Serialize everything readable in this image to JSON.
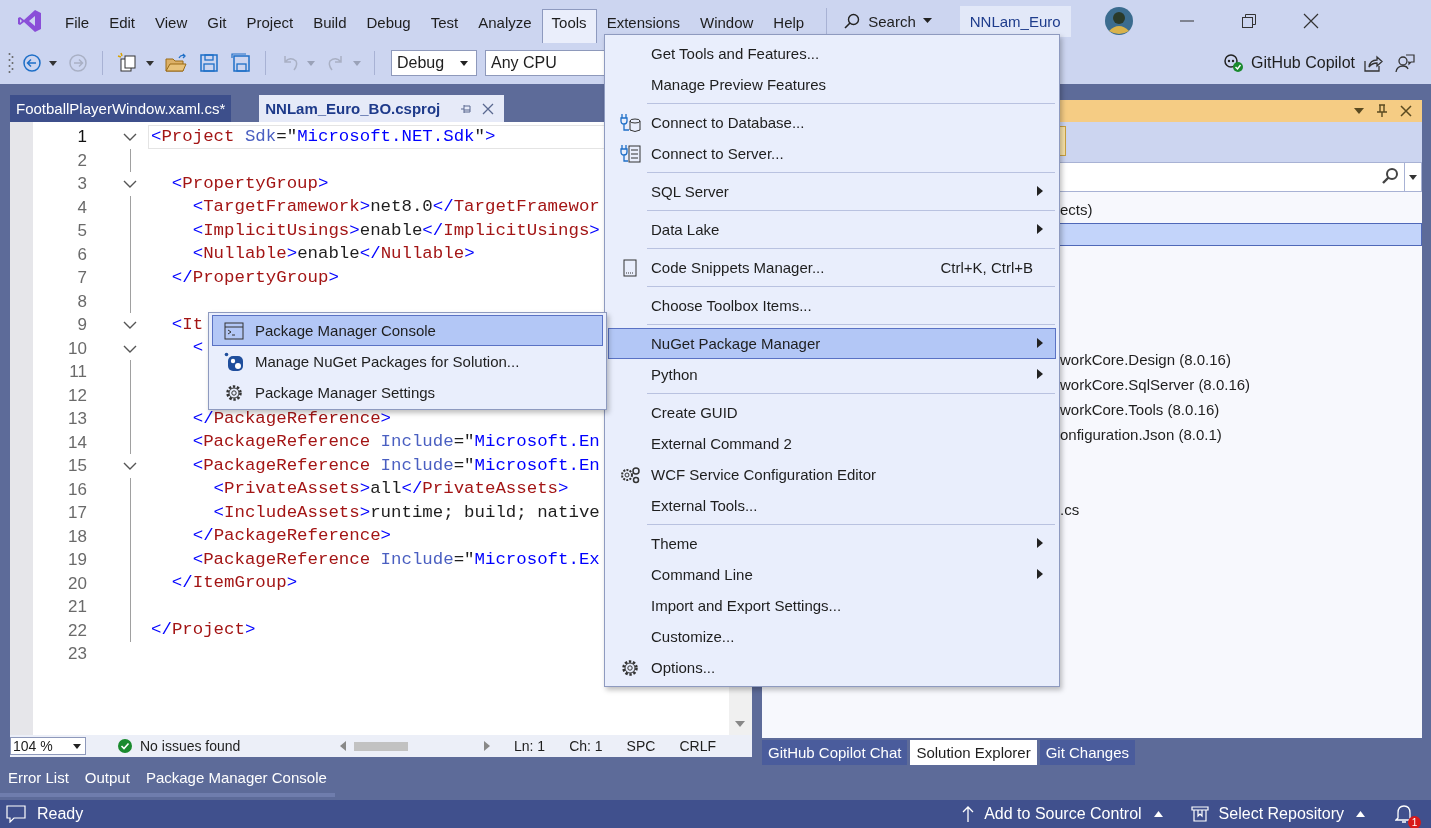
{
  "menu_bar": {
    "items": [
      {
        "label": "File",
        "selected": false
      },
      {
        "label": "Edit",
        "selected": false
      },
      {
        "label": "View",
        "selected": false
      },
      {
        "label": "Git",
        "selected": false
      },
      {
        "label": "Project",
        "selected": false
      },
      {
        "label": "Build",
        "selected": false
      },
      {
        "label": "Debug",
        "selected": false
      },
      {
        "label": "Test",
        "selected": false
      },
      {
        "label": "Analyze",
        "selected": false
      },
      {
        "label": "Tools",
        "selected": true
      },
      {
        "label": "Extensions",
        "selected": false
      },
      {
        "label": "Window",
        "selected": false
      },
      {
        "label": "Help",
        "selected": false
      }
    ],
    "search": "Search",
    "solution_name": "NNLam_Euro"
  },
  "toolbar": {
    "configuration": "Debug",
    "platform": "Any CPU",
    "copilot": "GitHub Copilot"
  },
  "editor": {
    "tabs": [
      {
        "label": "FootballPlayerWindow.xaml.cs*",
        "selected": false
      },
      {
        "label": "NNLam_Euro_BO.csproj",
        "selected": true
      }
    ],
    "lines": [
      {
        "number": "1",
        "current": true,
        "foldable": true,
        "tokens": [
          {
            "kind": "bracket",
            "text": "<"
          },
          {
            "kind": "tag",
            "text": "Project"
          },
          {
            "kind": "attr",
            "text": " Sdk"
          },
          {
            "kind": "punct",
            "text": "=\""
          },
          {
            "kind": "value",
            "text": "Microsoft.NET.Sdk"
          },
          {
            "kind": "punct",
            "text": "\""
          },
          {
            "kind": "bracket",
            "text": ">"
          }
        ]
      },
      {
        "number": "2",
        "current": false,
        "foldable": false
      },
      {
        "number": "3",
        "current": false,
        "foldable": true,
        "tokens": [
          {
            "kind": "bracket",
            "text": "  <"
          },
          {
            "kind": "tag",
            "text": "PropertyGroup"
          },
          {
            "kind": "bracket",
            "text": ">"
          }
        ]
      },
      {
        "number": "4",
        "current": false,
        "foldable": false,
        "tokens": [
          {
            "kind": "bracket",
            "text": "    <"
          },
          {
            "kind": "tag",
            "text": "TargetFramework"
          },
          {
            "kind": "bracket",
            "text": ">"
          },
          {
            "kind": "text",
            "text": "net8.0"
          },
          {
            "kind": "bracket",
            "text": "</"
          },
          {
            "kind": "tag",
            "text": "TargetFramewor"
          }
        ]
      },
      {
        "number": "5",
        "current": false,
        "foldable": false,
        "tokens": [
          {
            "kind": "bracket",
            "text": "    <"
          },
          {
            "kind": "tag",
            "text": "ImplicitUsings"
          },
          {
            "kind": "bracket",
            "text": ">"
          },
          {
            "kind": "text",
            "text": "enable"
          },
          {
            "kind": "bracket",
            "text": "</"
          },
          {
            "kind": "tag",
            "text": "ImplicitUsings"
          },
          {
            "kind": "bracket",
            "text": ">"
          }
        ]
      },
      {
        "number": "6",
        "current": false,
        "foldable": false,
        "tokens": [
          {
            "kind": "bracket",
            "text": "    <"
          },
          {
            "kind": "tag",
            "text": "Nullable"
          },
          {
            "kind": "bracket",
            "text": ">"
          },
          {
            "kind": "text",
            "text": "enable"
          },
          {
            "kind": "bracket",
            "text": "</"
          },
          {
            "kind": "tag",
            "text": "Nullable"
          },
          {
            "kind": "bracket",
            "text": ">"
          }
        ]
      },
      {
        "number": "7",
        "current": false,
        "foldable": false,
        "tokens": [
          {
            "kind": "bracket",
            "text": "  </"
          },
          {
            "kind": "tag",
            "text": "PropertyGroup"
          },
          {
            "kind": "bracket",
            "text": ">"
          }
        ]
      },
      {
        "number": "8",
        "current": false,
        "foldable": false
      },
      {
        "number": "9",
        "current": false,
        "foldable": true,
        "tokens": [
          {
            "kind": "bracket",
            "text": "  <"
          },
          {
            "kind": "tag",
            "text": "It"
          }
        ]
      },
      {
        "number": "10",
        "current": false,
        "foldable": true,
        "tokens": [
          {
            "kind": "bracket",
            "text": "    <"
          }
        ]
      },
      {
        "number": "11",
        "current": false,
        "foldable": false
      },
      {
        "number": "12",
        "current": false,
        "foldable": false
      },
      {
        "number": "13",
        "current": false,
        "foldable": false,
        "tokens": [
          {
            "kind": "bracket",
            "text": "    </"
          },
          {
            "kind": "tag",
            "text": "PackageReference"
          },
          {
            "kind": "bracket",
            "text": ">"
          }
        ]
      },
      {
        "number": "14",
        "current": false,
        "foldable": false,
        "tokens": [
          {
            "kind": "bracket",
            "text": "    <"
          },
          {
            "kind": "tag",
            "text": "PackageReference"
          },
          {
            "kind": "attr",
            "text": " Include"
          },
          {
            "kind": "punct",
            "text": "=\""
          },
          {
            "kind": "value",
            "text": "Microsoft.En"
          }
        ]
      },
      {
        "number": "15",
        "current": false,
        "foldable": true,
        "tokens": [
          {
            "kind": "bracket",
            "text": "    <"
          },
          {
            "kind": "tag",
            "text": "PackageReference"
          },
          {
            "kind": "attr",
            "text": " Include"
          },
          {
            "kind": "punct",
            "text": "=\""
          },
          {
            "kind": "value",
            "text": "Microsoft.En"
          }
        ]
      },
      {
        "number": "16",
        "current": false,
        "foldable": false,
        "tokens": [
          {
            "kind": "bracket",
            "text": "      <"
          },
          {
            "kind": "tag",
            "text": "PrivateAssets"
          },
          {
            "kind": "bracket",
            "text": ">"
          },
          {
            "kind": "text",
            "text": "all"
          },
          {
            "kind": "bracket",
            "text": "</"
          },
          {
            "kind": "tag",
            "text": "PrivateAssets"
          },
          {
            "kind": "bracket",
            "text": ">"
          }
        ]
      },
      {
        "number": "17",
        "current": false,
        "foldable": false,
        "tokens": [
          {
            "kind": "bracket",
            "text": "      <"
          },
          {
            "kind": "tag",
            "text": "IncludeAssets"
          },
          {
            "kind": "bracket",
            "text": ">"
          },
          {
            "kind": "text",
            "text": "runtime; build; native"
          }
        ]
      },
      {
        "number": "18",
        "current": false,
        "foldable": false,
        "tokens": [
          {
            "kind": "bracket",
            "text": "    </"
          },
          {
            "kind": "tag",
            "text": "PackageReference"
          },
          {
            "kind": "bracket",
            "text": ">"
          }
        ]
      },
      {
        "number": "19",
        "current": false,
        "foldable": false,
        "tokens": [
          {
            "kind": "bracket",
            "text": "    <"
          },
          {
            "kind": "tag",
            "text": "PackageReference"
          },
          {
            "kind": "attr",
            "text": " Include"
          },
          {
            "kind": "punct",
            "text": "=\""
          },
          {
            "kind": "value",
            "text": "Microsoft.Ex"
          }
        ]
      },
      {
        "number": "20",
        "current": false,
        "foldable": false,
        "tokens": [
          {
            "kind": "bracket",
            "text": "  </"
          },
          {
            "kind": "tag",
            "text": "ItemGroup"
          },
          {
            "kind": "bracket",
            "text": ">"
          }
        ]
      },
      {
        "number": "21",
        "current": false,
        "foldable": false
      },
      {
        "number": "22",
        "current": false,
        "foldable": false,
        "tokens": [
          {
            "kind": "bracket",
            "text": "</"
          },
          {
            "kind": "tag",
            "text": "Project"
          },
          {
            "kind": "bracket",
            "text": ">"
          }
        ]
      },
      {
        "number": "23",
        "current": false,
        "foldable": false
      }
    ],
    "zoom": "104 %",
    "issues": "No issues found",
    "position": [
      "Ln: 1",
      "Ch: 1",
      "SPC",
      "CRLF"
    ]
  },
  "tools_menu": {
    "groups": [
      [
        {
          "label": "Get Tools and Features...",
          "submenu": false,
          "selected": false
        },
        {
          "label": "Manage Preview Features",
          "submenu": false,
          "selected": false
        }
      ],
      [
        {
          "label": "Connect to Database...",
          "submenu": false,
          "selected": false
        },
        {
          "label": "Connect to Server...",
          "submenu": false,
          "selected": false
        }
      ],
      [
        {
          "label": "SQL Server",
          "submenu": true,
          "selected": false
        }
      ],
      [
        {
          "label": "Data Lake",
          "submenu": true,
          "selected": false
        }
      ],
      [
        {
          "label": "Code Snippets Manager...",
          "shortcut": "Ctrl+K, Ctrl+B",
          "submenu": false,
          "selected": false
        }
      ],
      [
        {
          "label": "Choose Toolbox Items...",
          "submenu": false,
          "selected": false
        }
      ],
      [
        {
          "label": "NuGet Package Manager",
          "submenu": true,
          "selected": true
        },
        {
          "label": "Python",
          "submenu": true,
          "selected": false
        }
      ],
      [
        {
          "label": "Create GUID",
          "submenu": false,
          "selected": false
        },
        {
          "label": "External Command 2",
          "submenu": false,
          "selected": false
        },
        {
          "label": "WCF Service Configuration Editor",
          "submenu": false,
          "selected": false
        },
        {
          "label": "External Tools...",
          "submenu": false,
          "selected": false
        }
      ],
      [
        {
          "label": "Theme",
          "submenu": true,
          "selected": false
        },
        {
          "label": "Command Line",
          "submenu": true,
          "selected": false
        },
        {
          "label": "Import and Export Settings...",
          "submenu": false,
          "selected": false
        },
        {
          "label": "Customize...",
          "submenu": false,
          "selected": false
        },
        {
          "label": "Options...",
          "submenu": false,
          "selected": false
        }
      ]
    ]
  },
  "nuget_submenu": {
    "items": [
      {
        "label": "Package Manager Console",
        "selected": true
      },
      {
        "label": "Manage NuGet Packages for Solution...",
        "selected": false
      },
      {
        "label": "Package Manager Settings",
        "selected": false
      }
    ]
  },
  "solution_explorer": {
    "rows": [
      {
        "text": "ects)",
        "selected": false
      },
      {
        "selected": true
      },
      {
        "selected": false
      },
      {
        "selected": false
      },
      {
        "selected": false
      },
      {
        "selected": false
      },
      {
        "text": "workCore.Design (8.0.16)",
        "selected": false
      },
      {
        "text": "workCore.SqlServer (8.0.16)",
        "selected": false
      },
      {
        "text": "workCore.Tools (8.0.16)",
        "selected": false
      },
      {
        "text": "onfiguration.Json (8.0.1)",
        "selected": false
      },
      {
        "selected": false
      },
      {
        "selected": false
      },
      {
        "text": ".cs",
        "selected": false
      }
    ],
    "tabs": [
      {
        "label": "GitHub Copilot Chat",
        "selected": false
      },
      {
        "label": "Solution Explorer",
        "selected": true
      },
      {
        "label": "Git Changes",
        "selected": false
      }
    ]
  },
  "tool_windows": {
    "tabs": [
      "Error List",
      "Output",
      "Package Manager Console"
    ]
  },
  "status_bar": {
    "ready": "Ready",
    "source_control": "Add to Source Control",
    "repository": "Select Repository",
    "notifications": "1"
  }
}
